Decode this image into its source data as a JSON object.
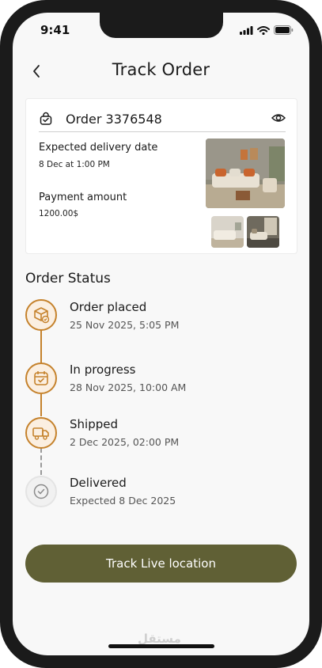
{
  "status_bar": {
    "time": "9:41"
  },
  "header": {
    "title": "Track Order"
  },
  "order": {
    "id_label": "Order 3376548",
    "delivery_label": "Expected delivery date",
    "delivery_value": "8 Dec at 1:00 PM",
    "payment_label": "Payment amount",
    "payment_value": "1200.00$"
  },
  "status": {
    "title": "Order Status",
    "steps": [
      {
        "title": "Order placed",
        "date": "25 Nov 2025, 5:05 PM",
        "state": "done",
        "icon": "box-check-icon"
      },
      {
        "title": "In progress",
        "date": "28 Nov 2025, 10:00 AM",
        "state": "done",
        "icon": "calendar-check-icon"
      },
      {
        "title": "Shipped",
        "date": "2 Dec 2025, 02:00 PM",
        "state": "done",
        "icon": "truck-check-icon"
      },
      {
        "title": "Delivered",
        "date": "Expected 8 Dec 2025",
        "state": "pending",
        "icon": "check-circle-icon"
      }
    ]
  },
  "actions": {
    "track_label": "Track Live location"
  },
  "colors": {
    "accent": "#c5822c",
    "button": "#606035",
    "background": "#f8f8f8"
  },
  "watermark": {
    "text": "مستقل"
  }
}
